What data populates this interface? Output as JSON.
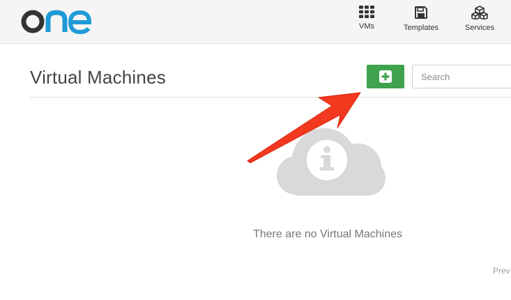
{
  "header": {
    "logo_alt": "one",
    "nav": [
      {
        "label": "VMs",
        "icon": "grid-icon"
      },
      {
        "label": "Templates",
        "icon": "save-icon"
      },
      {
        "label": "Services",
        "icon": "cubes-icon"
      }
    ]
  },
  "main": {
    "title": "Virtual Machines",
    "search": {
      "placeholder": "Search",
      "value": ""
    },
    "add_button_icon": "plus-square-icon",
    "empty_message": "There are no Virtual Machines",
    "pager_prev": "Prev"
  },
  "colors": {
    "accent_green": "#3fa34d",
    "logo_dark": "#333333",
    "logo_blue": "#1f9ad6",
    "annotation_arrow": "#f2381f"
  }
}
